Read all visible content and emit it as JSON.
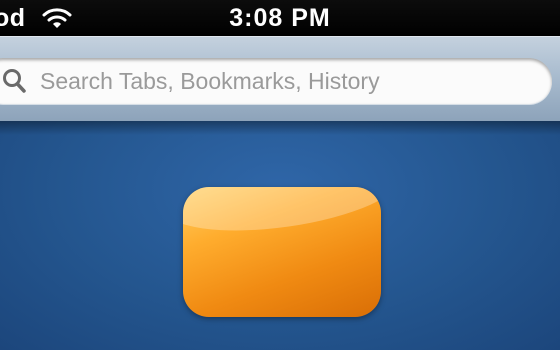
{
  "status_bar": {
    "carrier": "od",
    "time": "3:08 PM",
    "wifi_icon": "wifi-icon"
  },
  "search": {
    "placeholder": "Search Tabs, Bookmarks, History",
    "icon": "search-icon"
  },
  "colors": {
    "background": "#24568f",
    "search_bar": "#a9bccf",
    "app_tile": "#f59a1c"
  }
}
